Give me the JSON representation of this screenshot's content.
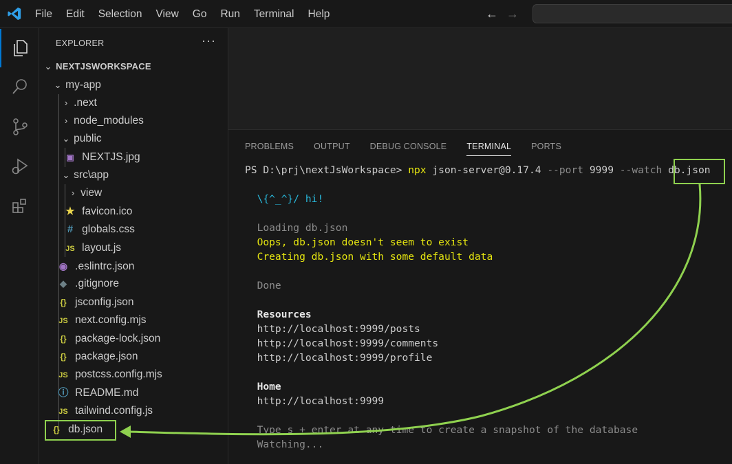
{
  "menu": {
    "items": [
      "File",
      "Edit",
      "Selection",
      "View",
      "Go",
      "Run",
      "Terminal",
      "Help"
    ],
    "back_arrow": "←",
    "forward_arrow": "→"
  },
  "colors": {
    "accent": "#0078d4",
    "highlight": "#8fd14f",
    "terminal_yellow": "#e5e510",
    "terminal_cyan": "#29b8db"
  },
  "explorer": {
    "title": "EXPLORER",
    "more": "···",
    "root": "NEXTJSWORKSPACE",
    "items": [
      {
        "label": "my-app",
        "icon": "chevron-down"
      },
      {
        "label": ".next",
        "icon": "chevron-right"
      },
      {
        "label": "node_modules",
        "icon": "chevron-right"
      },
      {
        "label": "public",
        "icon": "chevron-down"
      },
      {
        "label": "NEXTJS.jpg",
        "icon": "image-icon"
      },
      {
        "label": "src\\app",
        "icon": "chevron-down"
      },
      {
        "label": "view",
        "icon": "chevron-right"
      },
      {
        "label": "favicon.ico",
        "icon": "star-icon"
      },
      {
        "label": "globals.css",
        "icon": "hash-icon"
      },
      {
        "label": "layout.js",
        "icon": "js-icon"
      },
      {
        "label": ".eslintrc.json",
        "icon": "eslint-icon"
      },
      {
        "label": ".gitignore",
        "icon": "gitignore-icon"
      },
      {
        "label": "jsconfig.json",
        "icon": "json-icon"
      },
      {
        "label": "next.config.mjs",
        "icon": "js-icon"
      },
      {
        "label": "package-lock.json",
        "icon": "json-icon"
      },
      {
        "label": "package.json",
        "icon": "json-icon"
      },
      {
        "label": "postcss.config.mjs",
        "icon": "js-icon"
      },
      {
        "label": "README.md",
        "icon": "info-icon"
      },
      {
        "label": "tailwind.config.js",
        "icon": "js-icon"
      },
      {
        "label": "db.json",
        "icon": "json-icon"
      }
    ]
  },
  "panel": {
    "tabs": [
      "PROBLEMS",
      "OUTPUT",
      "DEBUG CONSOLE",
      "TERMINAL",
      "PORTS"
    ],
    "active_tab": "TERMINAL"
  },
  "terminal": {
    "prompt": "PS D:\\prj\\nextJsWorkspace> ",
    "cmd": "npx",
    "args_a": " json-server@0.17.4 ",
    "flag_port": "--port",
    "port": " 9999 ",
    "flag_watch": "--watch",
    "file_arg": "db.json",
    "hi": "\\{^_^}/ hi!",
    "loading": "Loading db.json",
    "oops": "Oops, db.json doesn't seem to exist",
    "creating": "Creating db.json with some default data",
    "done": "Done",
    "resources_title": "Resources",
    "resources": [
      "http://localhost:9999/posts",
      "http://localhost:9999/comments",
      "http://localhost:9999/profile"
    ],
    "home_title": "Home",
    "home_url": "http://localhost:9999",
    "snapshot": "Type s + enter at any time to create a snapshot of the database",
    "watching": "Watching..."
  }
}
